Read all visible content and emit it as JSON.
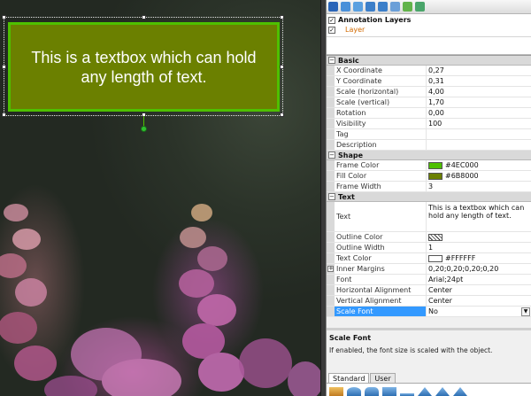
{
  "canvas": {
    "textbox_text": "This is a textbox which can hold any length of text."
  },
  "layers": {
    "root_label": "Annotation Layers",
    "child_label": "Layer"
  },
  "properties": {
    "categories": {
      "basic": "Basic",
      "shape": "Shape",
      "text": "Text"
    },
    "basic": [
      {
        "name": "X Coordinate",
        "value": "0,27"
      },
      {
        "name": "Y Coordinate",
        "value": "0,31"
      },
      {
        "name": "Scale (horizontal)",
        "value": "4,00"
      },
      {
        "name": "Scale (vertical)",
        "value": "1,70"
      },
      {
        "name": "Rotation",
        "value": "0,00"
      },
      {
        "name": "Visibility",
        "value": "100"
      },
      {
        "name": "Tag",
        "value": ""
      },
      {
        "name": "Description",
        "value": ""
      }
    ],
    "shape": {
      "frame_color": {
        "name": "Frame Color",
        "value": "#4EC000",
        "color": "#4EC000"
      },
      "fill_color": {
        "name": "Fill Color",
        "value": "#6B8000",
        "color": "#6B8000"
      },
      "frame_width": {
        "name": "Frame Width",
        "value": "3"
      }
    },
    "text": {
      "text": {
        "name": "Text",
        "value": "This is a textbox which can hold any length of text."
      },
      "outline_color": {
        "name": "Outline Color",
        "value": ""
      },
      "outline_width": {
        "name": "Outline Width",
        "value": "1"
      },
      "text_color": {
        "name": "Text Color",
        "value": "#FFFFFF",
        "color": "#FFFFFF"
      },
      "inner_margins": {
        "name": "Inner Margins",
        "value": "0,20;0,20;0,20;0,20"
      },
      "font": {
        "name": "Font",
        "value": "Arial;24pt"
      },
      "h_align": {
        "name": "Horizontal Alignment",
        "value": "Center"
      },
      "v_align": {
        "name": "Vertical Alignment",
        "value": "Center"
      },
      "scale_font": {
        "name": "Scale Font",
        "value": "No"
      }
    }
  },
  "description": {
    "title": "Scale Font",
    "text": "If enabled, the font size is scaled with the object."
  },
  "tabs": [
    "Standard",
    "User"
  ],
  "colors": {
    "accent_selected": "#3399ff",
    "layer_label": "#d26a00"
  }
}
